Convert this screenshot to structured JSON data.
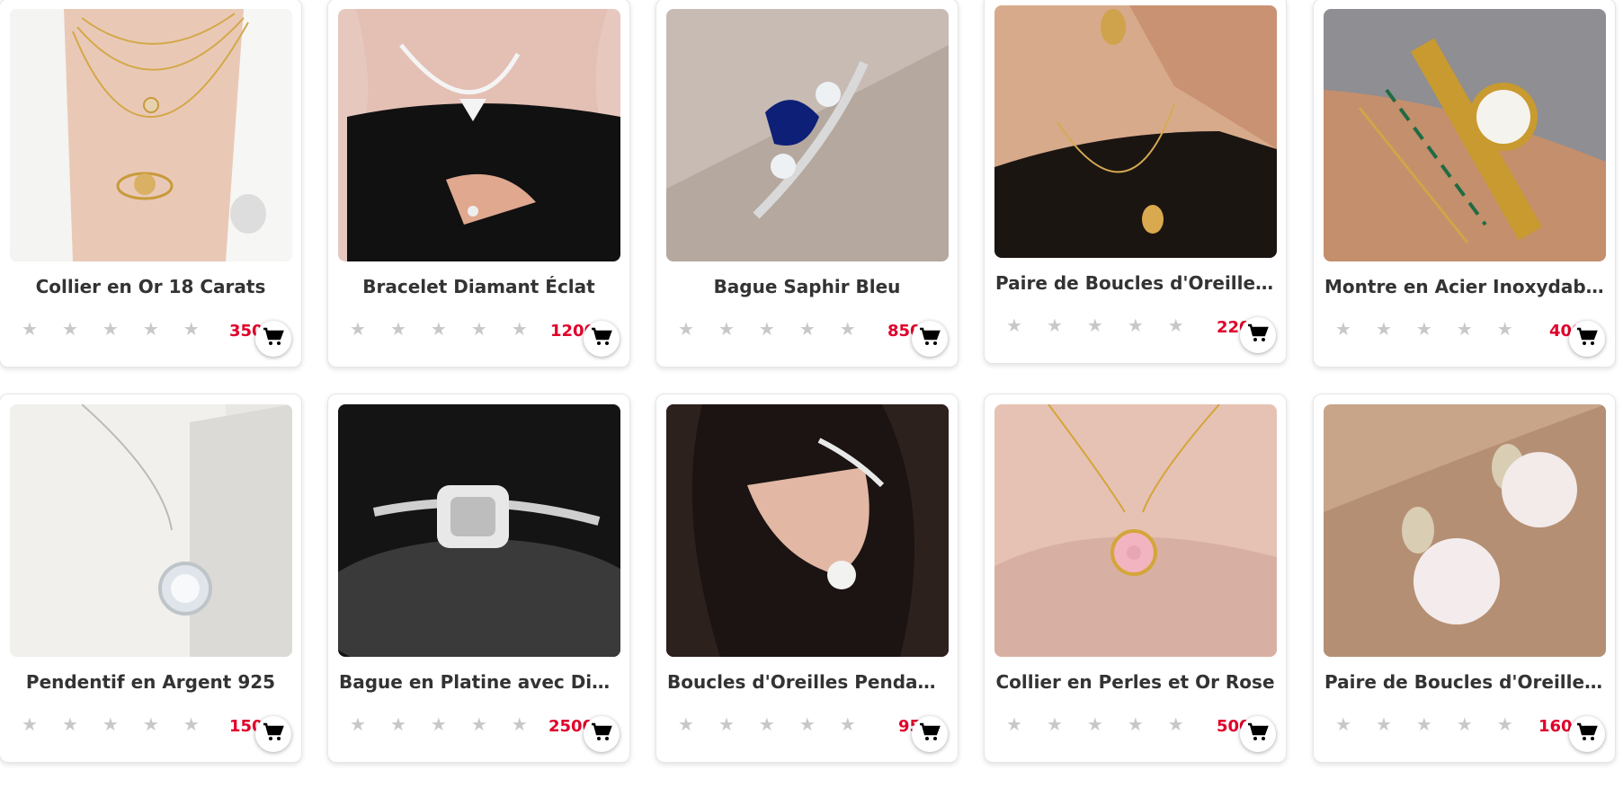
{
  "products": [
    {
      "title": "Collier en Or 18 Carats",
      "price": "350",
      "stars": 5,
      "image": "layered-gold-necklaces-photo"
    },
    {
      "title": "Bracelet Diamant Éclat",
      "price": "1200",
      "stars": 5,
      "image": "diamond-necklace-black-dress-photo"
    },
    {
      "title": "Bague Saphir Bleu",
      "price": "850",
      "stars": 5,
      "image": "sapphire-ring-photo"
    },
    {
      "title": "Paire de Boucles d'Oreilles P...",
      "price": "220",
      "stars": 5,
      "image": "gold-drop-earrings-photo"
    },
    {
      "title": "Montre en Acier Inoxydable",
      "price": "400",
      "stars": 5,
      "image": "gold-watch-bracelets-photo"
    },
    {
      "title": "Pendentif en Argent 925",
      "price": "150",
      "stars": 5,
      "image": "silver-pendant-photo"
    },
    {
      "title": "Bague en Platine avec Diam...",
      "price": "2500",
      "stars": 5,
      "image": "platinum-diamond-ring-photo"
    },
    {
      "title": "Boucles d'Oreilles Pendante...",
      "price": "95",
      "stars": 5,
      "image": "floral-earrings-woman-photo"
    },
    {
      "title": "Collier en Perles et Or Rose",
      "price": "500",
      "stars": 5,
      "image": "pink-flower-pendant-photo"
    },
    {
      "title": "Paire de Boucles d'Oreilles e...",
      "price": "1600",
      "stars": 5,
      "image": "pearl-drop-earrings-photo"
    }
  ],
  "icons": {
    "star": "star-icon",
    "cart": "shopping-cart-icon"
  },
  "colors": {
    "price": "#e0002a",
    "star_empty": "#c8c8c8",
    "card_border": "#e6e6e6"
  }
}
